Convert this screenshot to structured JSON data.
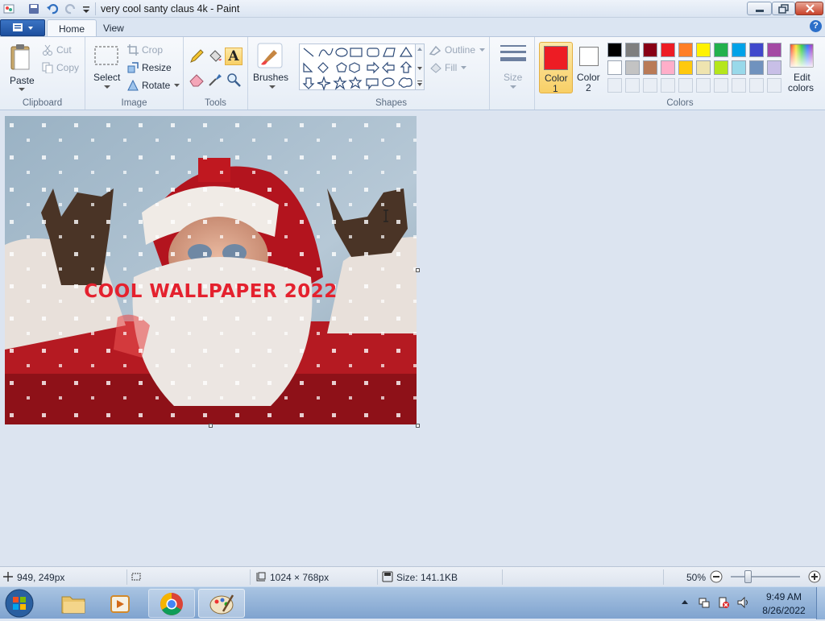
{
  "window": {
    "title": "very cool santy claus 4k - Paint"
  },
  "tabs": [
    {
      "label": "Home"
    },
    {
      "label": "View"
    }
  ],
  "clipboard": {
    "paste": "Paste",
    "cut": "Cut",
    "copy": "Copy",
    "group": "Clipboard"
  },
  "image": {
    "select": "Select",
    "crop": "Crop",
    "resize": "Resize",
    "rotate": "Rotate",
    "group": "Image"
  },
  "tools": {
    "group": "Tools"
  },
  "brushes": {
    "label": "Brushes"
  },
  "shapes": {
    "outline": "Outline",
    "fill": "Fill",
    "group": "Shapes"
  },
  "size": {
    "label": "Size"
  },
  "colors": {
    "color1_label_a": "Color",
    "color1_label_b": "1",
    "color2_label_a": "Color",
    "color2_label_b": "2",
    "edit_a": "Edit",
    "edit_b": "colors",
    "group": "Colors",
    "color1": "#ed1c24",
    "color2": "#ffffff",
    "palette_row1": [
      "#000000",
      "#7f7f7f",
      "#880015",
      "#ed1c24",
      "#ff7f27",
      "#fff200",
      "#22b14c",
      "#00a2e8",
      "#3f48cc",
      "#a349a4"
    ],
    "palette_row2": [
      "#ffffff",
      "#c3c3c3",
      "#b97a57",
      "#ffaec9",
      "#ffc90e",
      "#efe4b0",
      "#b5e61d",
      "#99d9ea",
      "#7092be",
      "#c8bfe7"
    ]
  },
  "canvas": {
    "caption": "COOL WALLPAPER 2022"
  },
  "status": {
    "cursor": "949, 249px",
    "dimensions": "1024 × 768px",
    "size": "Size: 141.1KB",
    "zoom": "50%"
  },
  "taskbar": {
    "time": "9:49 AM",
    "date": "8/26/2022"
  }
}
